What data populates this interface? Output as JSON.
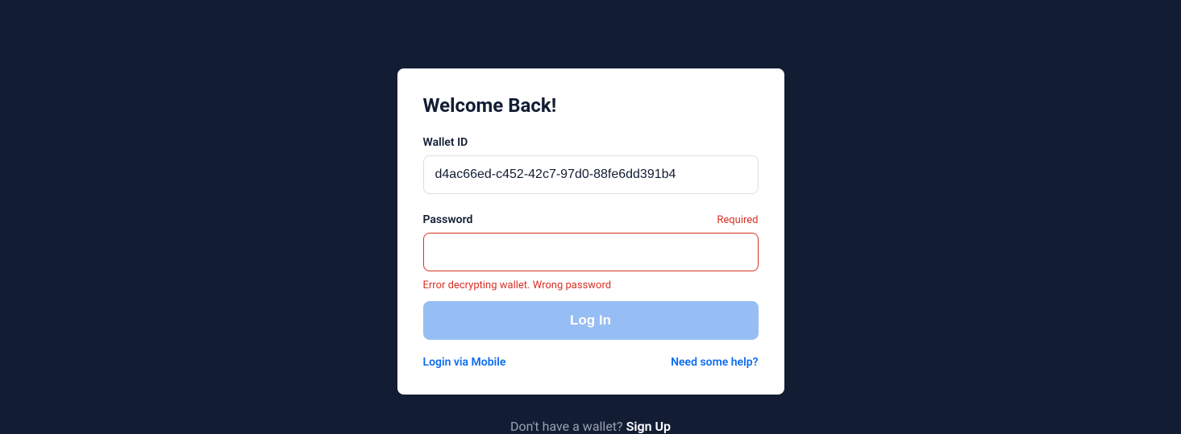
{
  "card": {
    "heading": "Welcome Back!",
    "walletId": {
      "label": "Wallet ID",
      "value": "d4ac66ed-c452-42c7-97d0-88fe6dd391b4"
    },
    "password": {
      "label": "Password",
      "required_text": "Required",
      "value": "",
      "error_message": "Error decrypting wallet. Wrong password"
    },
    "login_button": "Log In",
    "links": {
      "mobile": "Login via Mobile",
      "help": "Need some help?"
    }
  },
  "footer": {
    "text": "Don't have a wallet? ",
    "signup": "Sign Up"
  }
}
